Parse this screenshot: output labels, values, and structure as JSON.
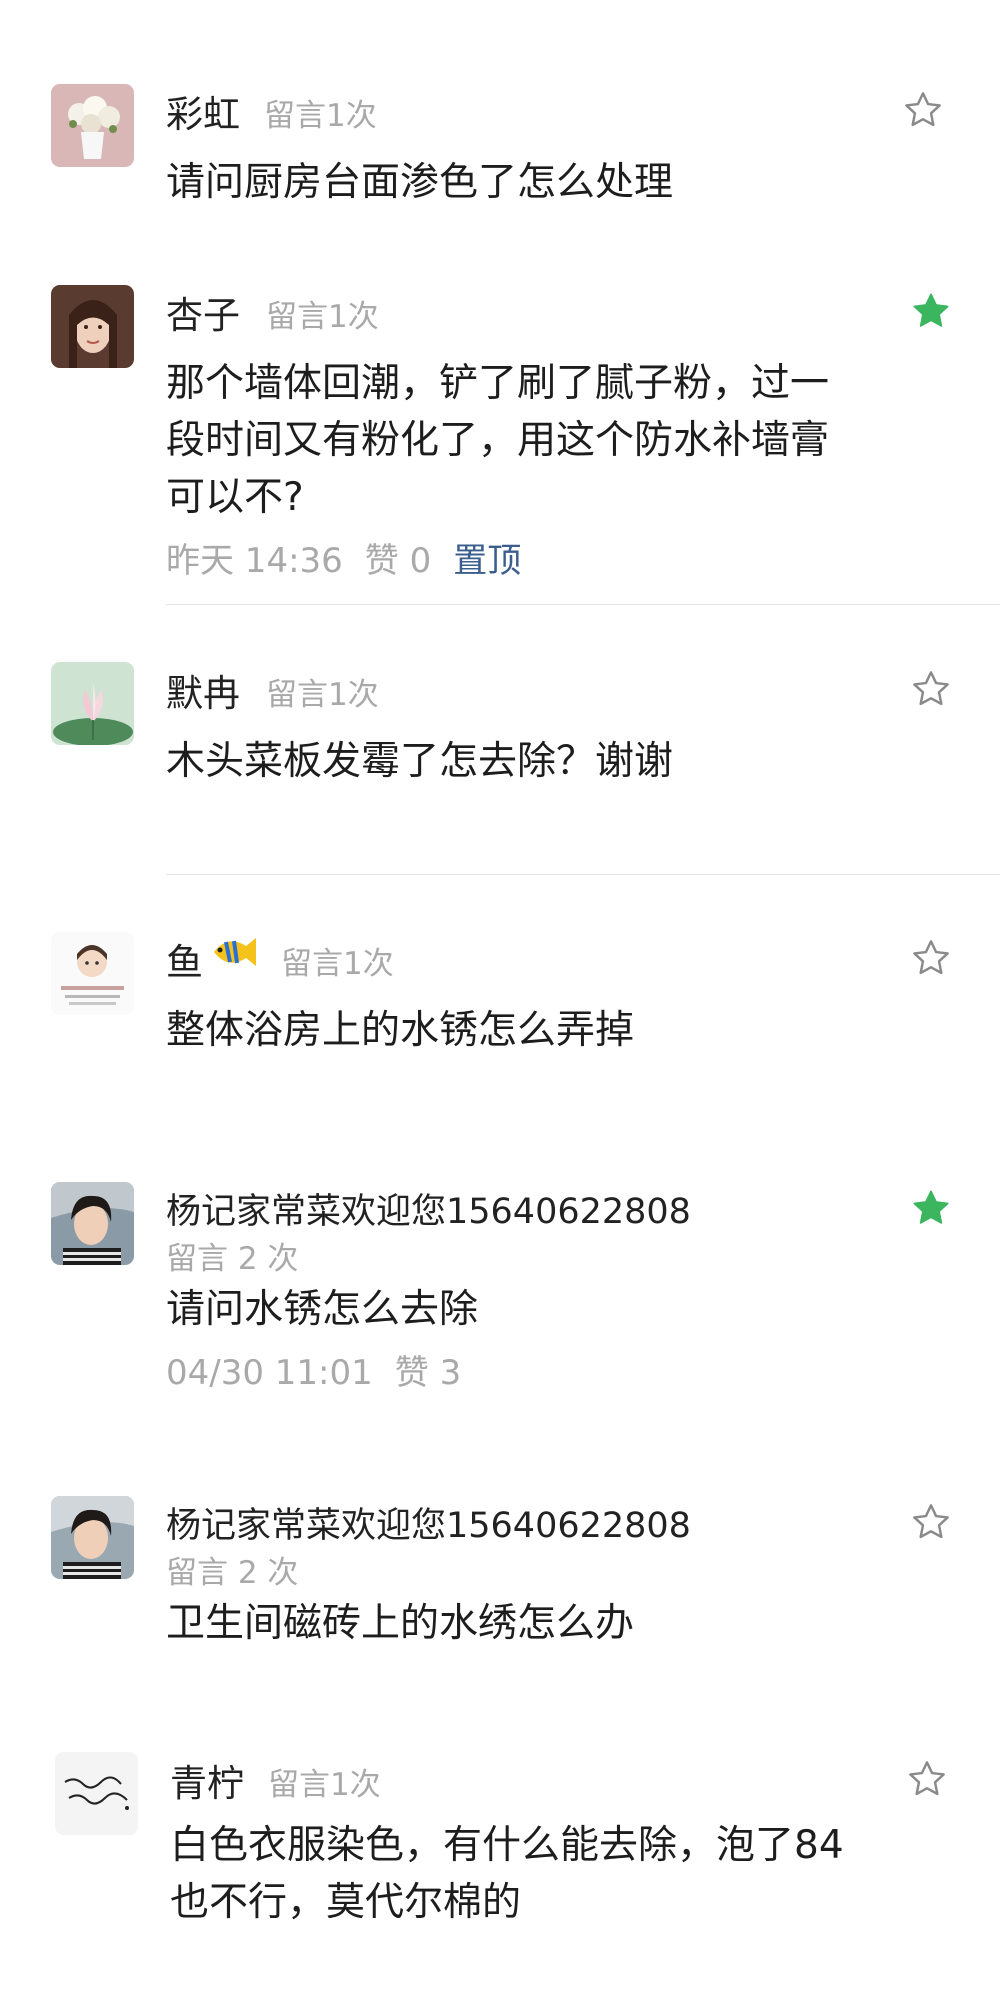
{
  "comments": [
    {
      "name": "彩虹",
      "badge": "留言1次",
      "text": "请问厨房台面渗色了怎么处理",
      "starred": false
    },
    {
      "name": "杏子",
      "badge": "留言1次",
      "text": "那个墙体回潮，铲了刷了腻子粉，过一段时间又有粉化了，用这个防水补墙膏可以不?",
      "time": "昨天 14:36",
      "likes": "赞 0",
      "pin": "置顶",
      "starred": true
    },
    {
      "name": "默冉",
      "badge": "留言1次",
      "text": "木头菜板发霉了怎去除？谢谢",
      "starred": false
    },
    {
      "name": "鱼",
      "badge": "留言1次",
      "text": "整体浴房上的水锈怎么弄掉",
      "starred": false
    },
    {
      "name": "杨记家常菜欢迎您15640622808",
      "badge": "留言 2 次",
      "text": "请问水锈怎么去除",
      "time": "04/30 11:01",
      "likes": "赞 3",
      "starred": true
    },
    {
      "name": "杨记家常菜欢迎您15640622808",
      "badge": "留言 2 次",
      "text": "卫生间磁砖上的水绣怎么办",
      "starred": false
    },
    {
      "name": "青柠",
      "badge": "留言1次",
      "text": "白色衣服染色，有什么能去除，泡了84也不行，莫代尔棉的",
      "starred": false
    }
  ],
  "icons": {
    "star": "star-outline-icon",
    "star_filled": "star-filled-icon",
    "fish": "fish-emoji-icon"
  },
  "colors": {
    "star_filled": "#3cb55f",
    "star_outline": "#8a8a8a",
    "pin_link": "#3b5e8f"
  }
}
